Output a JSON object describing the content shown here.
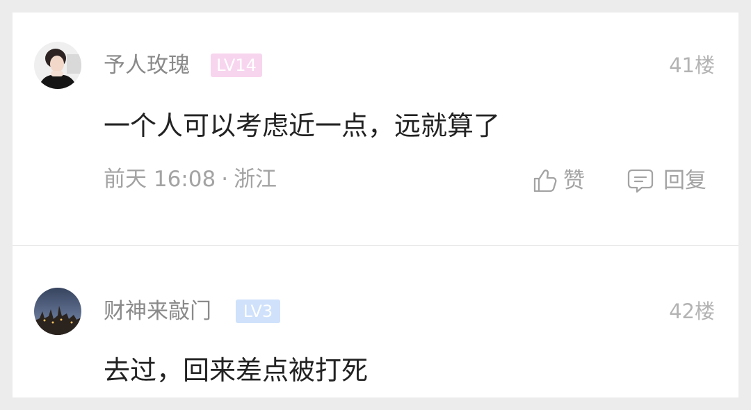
{
  "comments": [
    {
      "username": "予人玫瑰",
      "level": "LV14",
      "floor": "41楼",
      "content": "一个人可以考虑近一点，远就算了",
      "time": "前天 16:08",
      "separator": "·",
      "location": "浙江",
      "like_label": "赞",
      "reply_label": "回复",
      "level_badge_color": "#f8d5ee"
    },
    {
      "username": "财神来敲门",
      "level": "LV3",
      "floor": "42楼",
      "content": "去过，回来差点被打死",
      "level_badge_color": "#cfe1fb"
    }
  ],
  "icons": {
    "like": "thumbs-up-icon",
    "reply": "comment-icon"
  }
}
